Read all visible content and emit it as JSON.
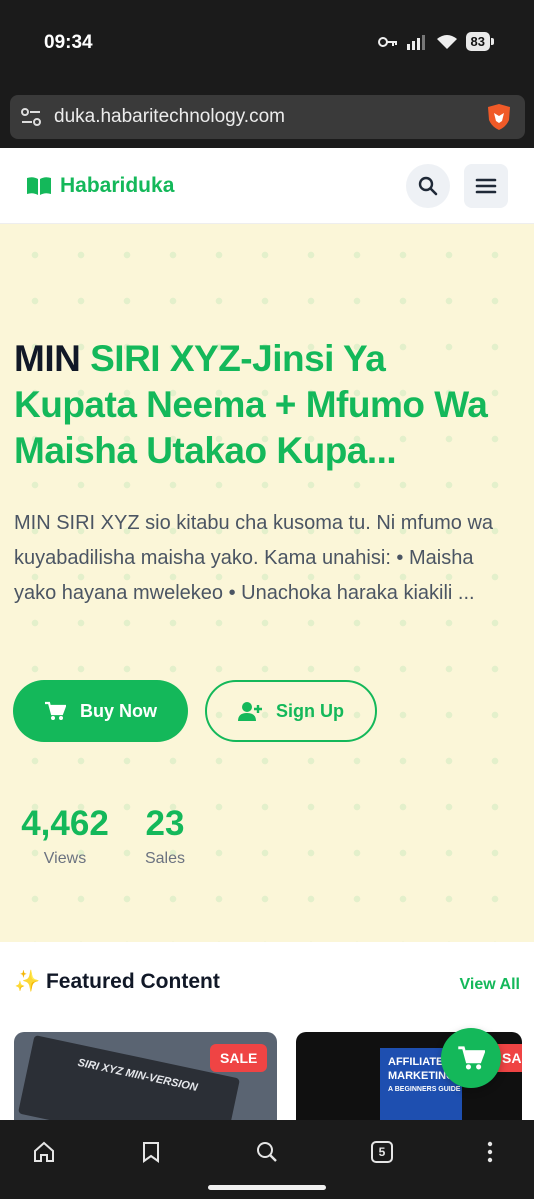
{
  "status": {
    "time": "09:34",
    "battery": "83"
  },
  "browser": {
    "url": "duka.habaritechnology.com",
    "tab_count": "5"
  },
  "site": {
    "brand": "Habariduka"
  },
  "hero": {
    "title_first": "MIN",
    "title_rest": "SIRI XYZ-Jinsi Ya Kupata Neema + Mfumo Wa Maisha Utakao Kupa...",
    "description": "MIN SIRI XYZ sio kitabu cha kusoma tu. Ni mfumo wa kuyabadilisha maisha yako. Kama unahisi: • Maisha yako hayana mwelekeo • Unachoka haraka kiakili ...",
    "buy_label": "Buy Now",
    "signup_label": "Sign Up",
    "stats": [
      {
        "value": "4,462",
        "label": "Views"
      },
      {
        "value": "23",
        "label": "Sales"
      }
    ]
  },
  "featured": {
    "title": "✨ Featured Content",
    "view_all": "View All",
    "cards": [
      {
        "badge": "SALE",
        "cover_text": "SIRI XYZ MIN-VERSION"
      },
      {
        "badge": "SA",
        "cover_lines": [
          "AFFILIATE",
          "MARKETING",
          "A BEGINNERS GUIDE"
        ]
      }
    ]
  },
  "colors": {
    "brand_green": "#14b85a",
    "hero_bg": "#fbf6d8",
    "sale_red": "#ef4444"
  }
}
